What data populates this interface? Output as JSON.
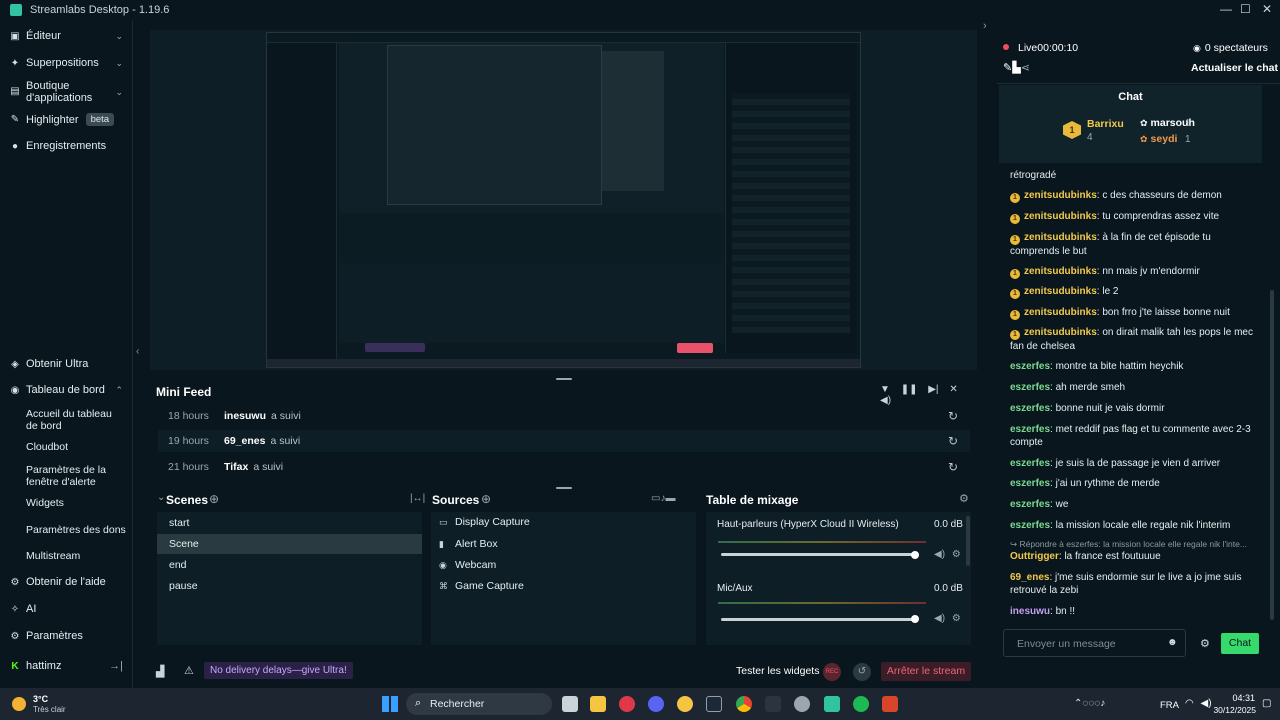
{
  "window": {
    "title": "Streamlabs Desktop - 1.19.6",
    "minimize": "—",
    "maximize": "☐",
    "close": "✕"
  },
  "nav": {
    "editor": "Éditeur",
    "overlays": "Superpositions",
    "store": "Boutique d'applications",
    "highlighter": "Highlighter",
    "highlighter_badge": "beta",
    "recordings": "Enregistrements",
    "ultra": "Obtenir Ultra",
    "dashboard": "Tableau de bord",
    "dashboard_sub": [
      "Accueil du tableau de bord",
      "Cloudbot",
      "Paramètres de la fenêtre d'alerte",
      "Widgets",
      "Paramètres des dons",
      "Multistream"
    ],
    "help": "Obtenir de l'aide",
    "ai": "AI",
    "settings": "Paramètres",
    "user": "hattimz"
  },
  "minifeed": {
    "title": "Mini Feed",
    "rows": [
      {
        "time": "18 hours",
        "user": "inesuwu",
        "action": "a suivi"
      },
      {
        "time": "19 hours",
        "user": "69_enes",
        "action": "a suivi"
      },
      {
        "time": "21 hours",
        "user": "Tifax",
        "action": "a suivi"
      }
    ]
  },
  "scenes": {
    "title": "Scenes",
    "items": [
      "start",
      "Scene",
      "end",
      "pause"
    ],
    "selected": "Scene"
  },
  "sources": {
    "title": "Sources",
    "items": [
      "Display Capture",
      "Alert Box",
      "Webcam",
      "Game Capture"
    ]
  },
  "mixer": {
    "title": "Table de mixage",
    "channels": [
      {
        "name": "Haut-parleurs (HyperX Cloud II Wireless)",
        "level": "0.0 dB",
        "fill": 1.0
      },
      {
        "name": "Mic/Aux",
        "level": "0.0 dB",
        "fill": 1.0
      }
    ]
  },
  "statusbar": {
    "promo": "No delivery delays—give Ultra!",
    "test_widgets": "Tester les widgets",
    "rec": "REC",
    "stop": "Arrêter le stream"
  },
  "stream": {
    "live": "Live",
    "timer": "00:00:10",
    "viewers": "0 spectateurs",
    "refresh": "Actualiser le chat"
  },
  "chat": {
    "title": "Chat",
    "top": [
      {
        "rank": "1",
        "name": "Barrixu",
        "count": "4"
      },
      {
        "name": "marsouh",
        "count": "1"
      },
      {
        "name": "seydi",
        "count": "1"
      }
    ],
    "messages": [
      {
        "user": "",
        "text": "rétrogradé",
        "color": "none"
      },
      {
        "user": "zenitsudubinks",
        "text": "c des chasseurs de demon",
        "color": "y"
      },
      {
        "user": "zenitsudubinks",
        "text": "tu comprendras assez vite",
        "color": "y"
      },
      {
        "user": "zenitsudubinks",
        "text": "à la fin de cet épisode tu comprends le but",
        "color": "y"
      },
      {
        "user": "zenitsudubinks",
        "text": "nn mais jv m'endormir",
        "color": "y"
      },
      {
        "user": "zenitsudubinks",
        "text": "le 2",
        "color": "y"
      },
      {
        "user": "zenitsudubinks",
        "text": "bon frro j'te laisse bonne nuit",
        "color": "y"
      },
      {
        "user": "zenitsudubinks",
        "text": "on dirait malik tah les pops le mec fan de chelsea",
        "color": "y"
      },
      {
        "user": "eszerfes",
        "text": "montre ta bite hattim heychik",
        "color": "g"
      },
      {
        "user": "eszerfes",
        "text": "ah merde smeh",
        "color": "g"
      },
      {
        "user": "eszerfes",
        "text": "bonne nuit je vais dormir",
        "color": "g"
      },
      {
        "user": "eszerfes",
        "text": "met reddif pas flag et tu commente avec 2-3 compte",
        "color": "g"
      },
      {
        "user": "eszerfes",
        "text": "je suis la de passage je vien d arriver",
        "color": "g"
      },
      {
        "user": "eszerfes",
        "text": "j'ai un rythme de merde",
        "color": "g"
      },
      {
        "user": "eszerfes",
        "text": "we",
        "color": "g"
      },
      {
        "user": "eszerfes",
        "text": "la mission locale elle regale nik l'interim",
        "color": "g"
      },
      {
        "user": "",
        "text": "↪ Répondre à eszerfes: la mission locale elle regale nik l'inte...",
        "color": "reply"
      },
      {
        "user": "Outtrigger",
        "text": "la france est foutuuue",
        "color": "y2"
      },
      {
        "user": "69_enes",
        "text": "j'me suis endormie sur le live a jo jme suis retrouvé la zebi",
        "color": "y2"
      },
      {
        "user": "inesuwu",
        "text": "bn !!",
        "color": "p"
      }
    ],
    "input_placeholder": "Envoyer un message",
    "send": "Chat"
  },
  "taskbar": {
    "weather_temp": "3°C",
    "weather_desc": "Très clair",
    "search": "Rechercher",
    "lang": "FRA",
    "time": "04:31",
    "date": "30/12/2025"
  },
  "colors": {
    "accent": "#31c3a2",
    "stop": "#e9526a",
    "promo": "#b48cff",
    "chat_btn": "#36d96b"
  }
}
